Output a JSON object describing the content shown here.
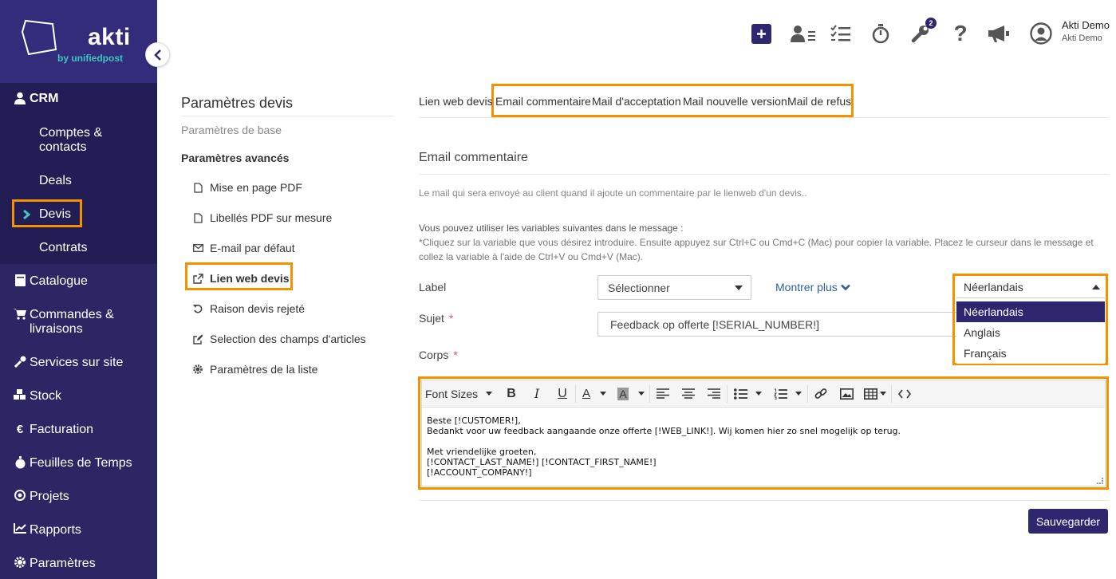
{
  "brand": {
    "name": "akti",
    "tagline": "by unifiedpost"
  },
  "sidebar": {
    "crm_label": "CRM",
    "crm_items": [
      {
        "label_line1": "Comptes &",
        "label_line2": "contacts"
      },
      {
        "label": "Deals"
      },
      {
        "label": "Devis"
      },
      {
        "label": "Contrats"
      }
    ],
    "items": [
      {
        "icon": "book-icon",
        "label": "Catalogue"
      },
      {
        "icon": "cart-icon",
        "label_line1": "Commandes &",
        "label_line2": "livraisons"
      },
      {
        "icon": "wrench-icon",
        "label": "Services sur site"
      },
      {
        "icon": "cubes-icon",
        "label": "Stock"
      },
      {
        "icon": "euro-icon",
        "label": "Facturation"
      },
      {
        "icon": "stopwatch-icon",
        "label": "Feuilles de Temps"
      },
      {
        "icon": "target-icon",
        "label": "Projets"
      },
      {
        "icon": "chart-icon",
        "label": "Rapports"
      },
      {
        "icon": "gear-icon",
        "label": "Paramètres"
      }
    ]
  },
  "topbar": {
    "notification_count": "2",
    "user_name": "Akti Demo",
    "user_company": "Akti Demo"
  },
  "settings_menu": {
    "title": "Paramètres devis",
    "base": "Paramètres de base",
    "advanced": "Paramètres avancés",
    "links": [
      {
        "icon": "pdf-icon",
        "label": "Mise en page PDF"
      },
      {
        "icon": "pdf-icon",
        "label": "Libellés PDF sur mesure"
      },
      {
        "icon": "envelope-icon",
        "label": "E-mail par défaut"
      },
      {
        "icon": "external-link-icon",
        "label": "Lien web devis"
      },
      {
        "icon": "undo-icon",
        "label": "Raison devis rejeté"
      },
      {
        "icon": "edit-icon",
        "label": "Selection des champs d'articles"
      },
      {
        "icon": "gear-icon",
        "label": "Paramètres de la liste"
      }
    ]
  },
  "tabs": [
    "Lien web devis",
    "Email commentaire",
    "Mail d'acceptation",
    "Mail nouvelle version",
    "Mail de refus"
  ],
  "main": {
    "section_title": "Email commentaire",
    "description": "Le mail qui sera envoyé au client quand il ajoute un commentaire par le lienweb d'un devis..",
    "vars_intro": "Vous pouvez utiliser les variables suivantes dans le message :",
    "vars_help": "*Cliquez sur la variable que vous désirez introduire. Ensuite appuyez sur Ctrl+C ou Cmd+C (Mac) pour copier la variable. Placez le curseur dans le message et collez la variable à l'aide de Ctrl+V ou Cmd+V (Mac).",
    "label_label": "Label",
    "label_select": "Sélectionner",
    "show_more": "Montrer plus",
    "subject_label": "Sujet",
    "subject_value": "Feedback op offerte [!SERIAL_NUMBER!]",
    "body_label": "Corps",
    "required_mark": "*",
    "save": "Sauvegarder"
  },
  "language": {
    "selected": "Néerlandais",
    "options": [
      "Néerlandais",
      "Anglais",
      "Français"
    ]
  },
  "editor": {
    "font_sizes": "Font Sizes",
    "body": "Beste [!CUSTOMER!],\nBedankt voor uw feedback aangaande onze offerte [!WEB_LINK!]. Wij komen hier zo snel mogelijk op terug.\n\nMet vriendelijke groeten,\n[!CONTACT_LAST_NAME!] [!CONTACT_FIRST_NAME!]\n[!ACCOUNT_COMPANY!]"
  },
  "colors": {
    "sidebar": "#2c2764",
    "highlight": "#f39200",
    "primary": "#2e2770"
  }
}
